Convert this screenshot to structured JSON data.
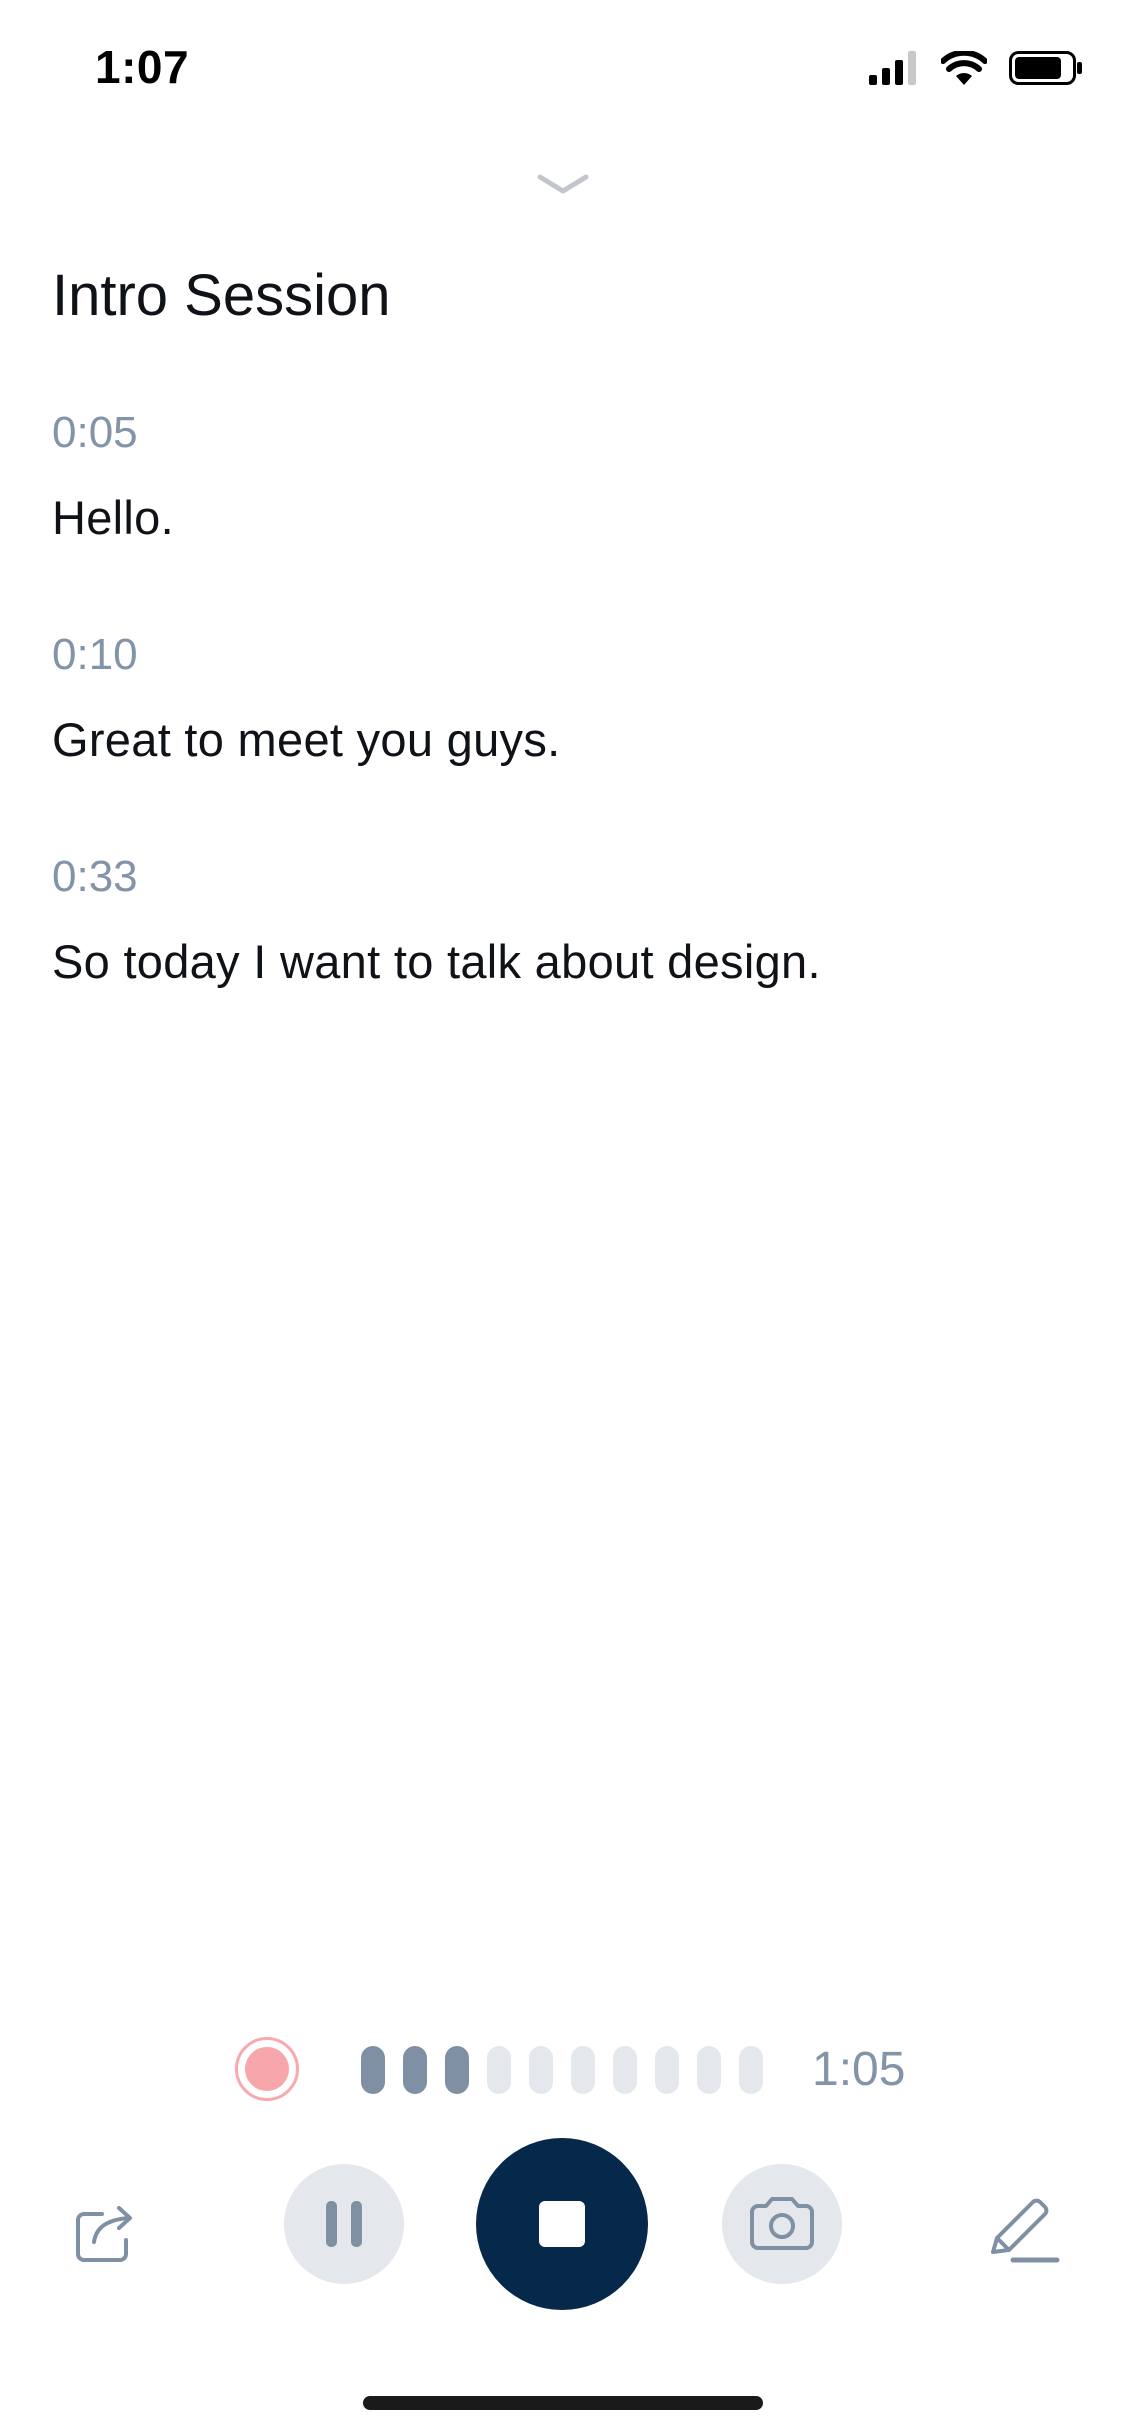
{
  "status_bar": {
    "time": "1:07",
    "icons": [
      "cellular-signal-icon",
      "wifi-icon",
      "battery-icon"
    ]
  },
  "header": {
    "collapse_icon": "chevron-down-icon",
    "title": "Intro Session"
  },
  "transcript": [
    {
      "time": "0:05",
      "text": "Hello."
    },
    {
      "time": "0:10",
      "text": "Great to meet you guys."
    },
    {
      "time": "0:33",
      "text": "So today I want to talk about design."
    }
  ],
  "recording": {
    "indicator_icon": "record-dot-icon",
    "level_bars_total": 10,
    "level_bars_active": 3,
    "elapsed": "1:05"
  },
  "controls": {
    "share_icon": "share-icon",
    "pause_icon": "pause-icon",
    "stop_icon": "stop-icon",
    "camera_icon": "camera-icon",
    "pen_icon": "pen-icon"
  },
  "colors": {
    "accent": "#06284a",
    "muted": "#8494a8",
    "button_bg": "#e4e7eb",
    "record": "#f7a6ab"
  }
}
